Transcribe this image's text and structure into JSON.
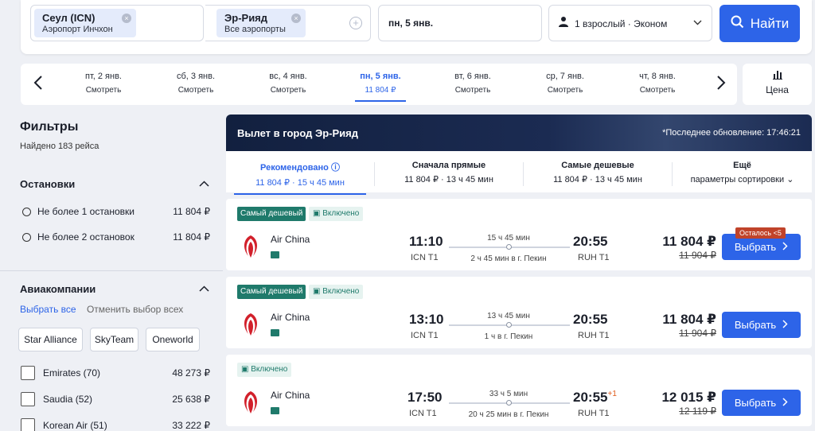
{
  "search": {
    "origin": {
      "city": "Сеул (ICN)",
      "airport": "Аэропорт Инчхон"
    },
    "destination": {
      "city": "Эр-Рияд",
      "airport": "Все аэропорты"
    },
    "date": "пн, 5 янв.",
    "passengers": "1 взрослый · Эконом",
    "find_label": "Найти"
  },
  "dates": [
    {
      "day": "пт, 2 янв.",
      "sub": "Смотреть"
    },
    {
      "day": "сб, 3 янв.",
      "sub": "Смотреть"
    },
    {
      "day": "вс, 4 янв.",
      "sub": "Смотреть"
    },
    {
      "day": "пн, 5 янв.",
      "sub": "11 804 ₽"
    },
    {
      "day": "вт, 6 янв.",
      "sub": "Смотреть"
    },
    {
      "day": "ср, 7 янв.",
      "sub": "Смотреть"
    },
    {
      "day": "чт, 8 янв.",
      "sub": "Смотреть"
    }
  ],
  "price_tab": {
    "label": "Цена"
  },
  "filters": {
    "title": "Фильтры",
    "found": "Найдено 183 рейса",
    "stops_title": "Остановки",
    "stops": [
      {
        "label": "Не более 1 остановки",
        "price": "11 804 ₽"
      },
      {
        "label": "Не более 2 остановок",
        "price": "11 804 ₽"
      }
    ],
    "airlines_title": "Авиакомпании",
    "select_all": "Выбрать все",
    "deselect_all": "Отменить выбор всех",
    "alliances": [
      "Star Alliance",
      "SkyTeam",
      "Oneworld"
    ],
    "airlines": [
      {
        "label": "Emirates (70)",
        "price": "48 273 ₽"
      },
      {
        "label": "Saudia (52)",
        "price": "25 638 ₽"
      },
      {
        "label": "Korean Air (51)",
        "price": "33 222 ₽"
      }
    ]
  },
  "results": {
    "header_title": "Вылет в город Эр-Рияд",
    "updated": "*Последнее обновление: 17:46:21",
    "sort_tabs": [
      {
        "title": "Рекомендовано",
        "sub": "11 804 ₽ · 15 ч 45 мин"
      },
      {
        "title": "Сначала прямые",
        "sub": "11 804 ₽ · 13 ч 45 мин"
      },
      {
        "title": "Самые дешевые",
        "sub": "11 804 ₽ · 13 ч 45 мин"
      },
      {
        "title": "Ещё",
        "sub": "параметры сортировки"
      }
    ],
    "cards": [
      {
        "tag": "Самый дешевый",
        "included": "Включено",
        "airline": "Air China",
        "dep_time": "11:10",
        "dep_airport": "ICN T1",
        "duration": "15 ч 45 мин",
        "stop": "2 ч 45 мин в г. Пекин",
        "arr_time": "20:55",
        "arr_plus": "",
        "arr_airport": "RUH T1",
        "price": "11 804 ₽",
        "old_price": "11 904 ₽",
        "remaining": "Осталось <5",
        "select": "Выбрать"
      },
      {
        "tag": "Самый дешевый",
        "included": "Включено",
        "airline": "Air China",
        "dep_time": "13:10",
        "dep_airport": "ICN T1",
        "duration": "13 ч 45 мин",
        "stop": "1 ч в г. Пекин",
        "arr_time": "20:55",
        "arr_plus": "",
        "arr_airport": "RUH T1",
        "price": "11 804 ₽",
        "old_price": "11 904 ₽",
        "remaining": "",
        "select": "Выбрать"
      },
      {
        "tag": "",
        "included": "Включено",
        "airline": "Air China",
        "dep_time": "17:50",
        "dep_airport": "ICN T1",
        "duration": "33 ч 5 мин",
        "stop": "20 ч 25 мин в г. Пекин",
        "arr_time": "20:55",
        "arr_plus": "+1",
        "arr_airport": "RUH T1",
        "price": "12 015 ₽",
        "old_price": "12 119 ₽",
        "remaining": "",
        "select": "Выбрать"
      }
    ]
  }
}
